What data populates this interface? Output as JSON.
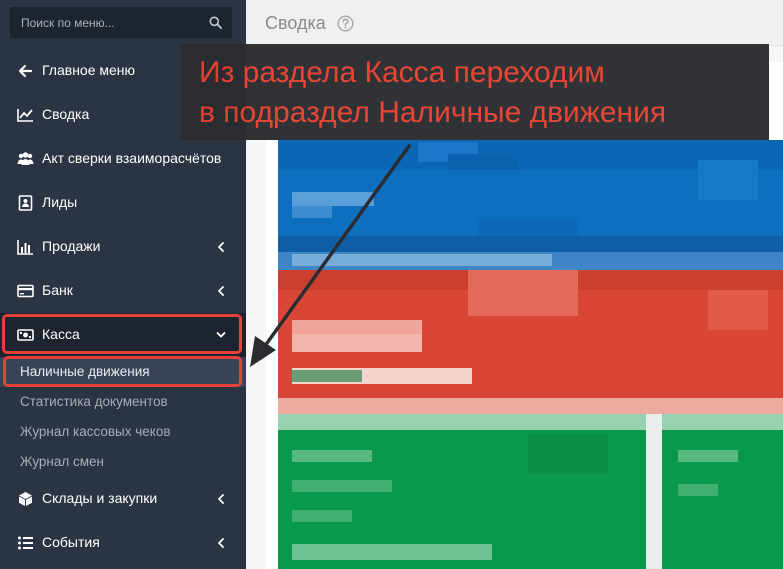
{
  "search": {
    "placeholder": "Поиск по меню..."
  },
  "sidebar": {
    "items": [
      {
        "label": "Главное меню"
      },
      {
        "label": "Сводка"
      },
      {
        "label": "Акт сверки взаиморасчётов"
      },
      {
        "label": "Лиды"
      },
      {
        "label": "Продажи"
      },
      {
        "label": "Банк"
      },
      {
        "label": "Касса"
      },
      {
        "label": "Склады и закупки"
      },
      {
        "label": "События"
      }
    ],
    "kassa_subitems": [
      {
        "label": "Наличные движения"
      },
      {
        "label": "Статистика документов"
      },
      {
        "label": "Журнал кассовых чеков"
      },
      {
        "label": "Журнал смен"
      }
    ]
  },
  "page": {
    "title": "Сводка"
  },
  "annotation": {
    "line1": "Из раздела Касса переходим",
    "line2": "в подраздел Наличные движения"
  },
  "colors": {
    "sidebar_bg": "#2b3443",
    "accent_red": "#e6413a",
    "tile_blue": "#0f6fbf",
    "tile_red": "#d94636",
    "tile_green": "#0a9a4e"
  }
}
